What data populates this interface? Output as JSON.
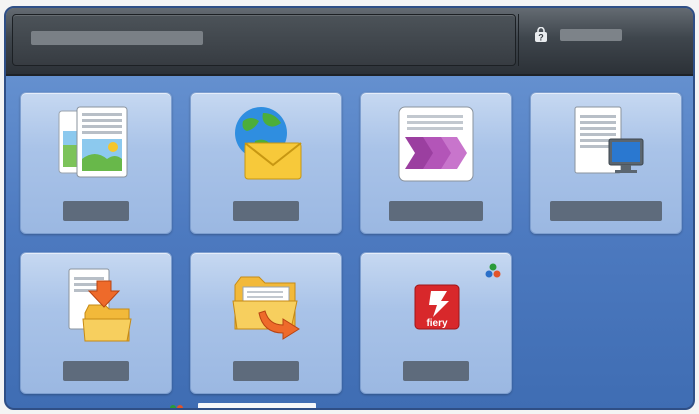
{
  "header": {
    "title": "",
    "help_label": ""
  },
  "tiles": [
    {
      "id": "copy",
      "icon": "copy-document-icon",
      "label": ""
    },
    {
      "id": "email",
      "icon": "globe-envelope-icon",
      "label": ""
    },
    {
      "id": "workflow",
      "icon": "workflow-arrows-icon",
      "label": ""
    },
    {
      "id": "scan-to-pc",
      "icon": "document-computer-icon",
      "label": ""
    },
    {
      "id": "scan-to-folder",
      "icon": "document-folder-arrow-icon",
      "label": ""
    },
    {
      "id": "send-from-folder",
      "icon": "folder-arrow-out-icon",
      "label": ""
    },
    {
      "id": "fiery",
      "icon": "fiery-logo-icon",
      "label": "",
      "brand_text": "fiery"
    }
  ],
  "colors": {
    "accent": "#4d7ac0",
    "header": "#3f464d",
    "fiery_red": "#d8282b"
  }
}
